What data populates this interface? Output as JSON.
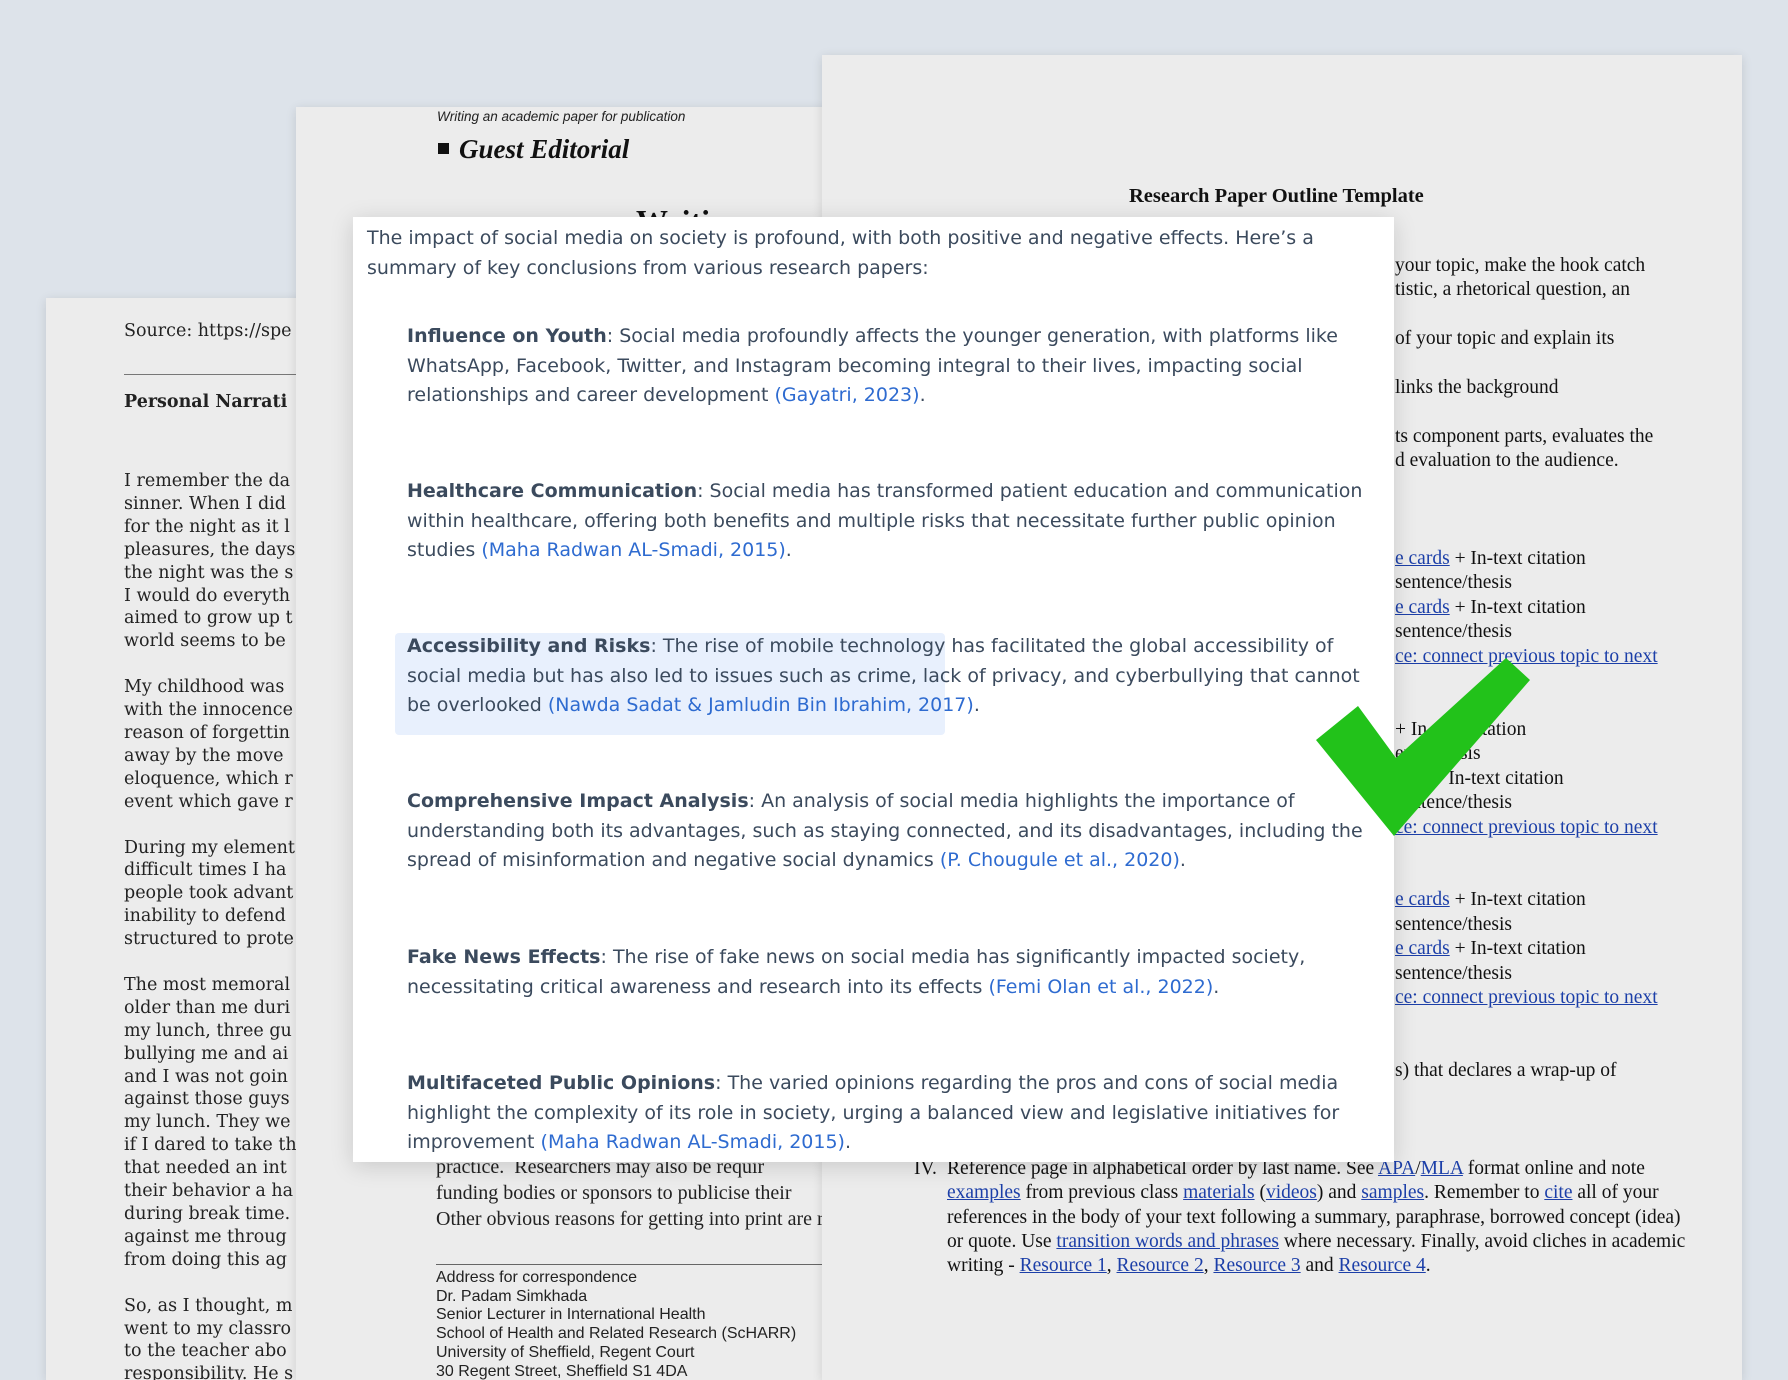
{
  "left_doc": {
    "source": "Source: https://spe",
    "title": "Personal Narrati",
    "body_lines": "I remember the da\nsinner. When I did\nfor the night as it l\npleasures, the days\nthe night was the s\nI would do everyth\naimed to grow up t\nworld seems to be \n\nMy childhood was \nwith the innocence\nreason of forgettin\naway by the move\neloquence, which r\nevent which gave r\n\nDuring my element\ndifficult times I ha\npeople took advant\ninability to defend\nstructured to prote\n\nThe most memoral\nolder than me duri\nmy lunch, three gu\nbullying me and ai\nand I was not goin\nagainst those guys\nmy lunch. They we\nif I dared to take th\nthat needed an int\ntheir behavior a ha\nduring break time.\nagainst me throug\nfrom doing this ag\n\nSo, as I thought, m\nwent to my classro\nto the teacher abo\nresponsibility. He s"
  },
  "middle_doc": {
    "running_header": "Writing an academic paper for publication",
    "section": "Guest Editorial",
    "title_fragment": "Writi",
    "body_lines": "practice.  Researchers may also be requir\nfunding bodies or sponsors to publicise their\nOther obvious reasons for getting into print are r",
    "address_lines": "Address for correspondence\nDr. Padam Simkhada\nSenior Lecturer in International Health\nSchool of Health and Related Research (ScHARR)\nUniversity of Sheffield, Regent Court\n30 Regent Street, Sheffield S1 4DA"
  },
  "right_doc": {
    "title": "Research Paper Outline Template",
    "fragments": [
      {
        "text": "your topic, make the hook catch",
        "top": 0
      },
      {
        "text": "tistic, a rhetorical question, an"
      },
      {
        "text": "of your topic and explain its"
      },
      {
        "text": "links the background"
      },
      {
        "text": "ts component parts, evaluates the"
      },
      {
        "text": "d evaluation to the audience."
      }
    ],
    "f1": "your topic, make the hook catch",
    "f2": "tistic, a rhetorical question, an",
    "f3": "of your topic and explain its",
    "f4": "links the background",
    "f5": "ts component parts, evaluates the",
    "f6": "d evaluation to the audience.",
    "cards_link": "e cards",
    "ards_link": "ards",
    "citation": " + In-text citation",
    "sentence_thesis": "sentence/thesis",
    "ence_thesis": "ence/thesis",
    "transition_link": "ce: connect previous topic to next",
    "wrapup": "s) that declares a wrap-up of",
    "ref_num": "IV.",
    "ref_t1": "Reference page in alphabetical order by last name. See ",
    "ref_apa": "APA",
    "ref_slash": "/",
    "ref_mla": "MLA",
    "ref_t2": " format online and note ",
    "ref_examples": "examples",
    "ref_t3": " from previous class ",
    "ref_materials": "materials",
    "ref_t4": " (",
    "ref_videos": "videos",
    "ref_t5": ") and ",
    "ref_samples": "samples",
    "ref_t6": ". Remember to ",
    "ref_cite": "cite",
    "ref_t7": " all of your references in the body of your text following a summary, paraphrase, borrowed concept (idea) or quote. Use ",
    "ref_transition": "transition words and phrases",
    "ref_t8": " where necessary. Finally, avoid cliches in academic writing - ",
    "ref_r1": "Resource 1",
    "ref_c1": ", ",
    "ref_r2": "Resource 2",
    "ref_c2": ", ",
    "ref_r3": "Resource 3",
    "ref_and": " and ",
    "ref_r4": "Resource 4",
    "ref_end": "."
  },
  "summary": {
    "intro": "The impact of social media on society is profound, with both positive and negative effects. Here’s a summary of key conclusions from various research papers:",
    "items": [
      {
        "heading": "Influence on Youth",
        "text": ": Social media profoundly affects the younger generation, with platforms like WhatsApp, Facebook, Twitter, and Instagram becoming integral to their lives, impacting social relationships and career development ",
        "citation": "(Gayatri, 2023)",
        "end": "."
      },
      {
        "heading": "Healthcare Communication",
        "text": ": Social media has transformed patient education and communication within healthcare, offering both benefits and multiple risks that necessitate further public opinion studies ",
        "citation": "(Maha Radwan AL-Smadi, 2015)",
        "end": "."
      },
      {
        "heading": "Accessibility and Risks",
        "text": ": The rise of mobile technology has facilitated the global accessibility of social media but has also led to issues such as crime, lack of privacy, and cyberbullying that cannot be overlooked ",
        "citation": "(Nawda Sadat & Jamludin Bin Ibrahim, 2017)",
        "end": "."
      },
      {
        "heading": "Comprehensive Impact Analysis",
        "text": ": An analysis of social media highlights the importance of understanding both its advantages, such as staying connected, and its disadvantages, including the spread of misinformation and negative social dynamics ",
        "citation": "(P. Chougule et al., 2020)",
        "end": "."
      },
      {
        "heading": "Fake News Effects",
        "text": ": The rise of fake news on social media has significantly impacted society, necessitating critical awareness and research into its effects ",
        "citation": "(Femi Olan et al., 2022)",
        "end": "."
      },
      {
        "heading": "Multifaceted Public Opinions",
        "text": ": The varied opinions regarding the pros and cons of social media highlight the complexity of its role in society, urging a balanced view and legislative initiatives for improvement ",
        "citation": "(Maha Radwan AL-Smadi, 2015)",
        "end": "."
      }
    ]
  },
  "colors": {
    "citation": "#2e6bd0",
    "highlight": "#e8f0fd",
    "checkmark": "#22c21a",
    "background": "#dde3ea"
  },
  "icons": {
    "checkmark": "checkmark-icon"
  }
}
